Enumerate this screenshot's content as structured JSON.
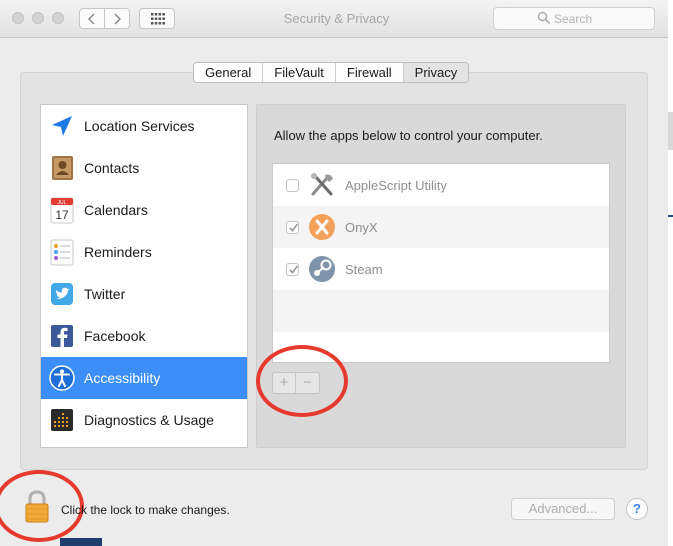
{
  "window": {
    "title": "Security & Privacy",
    "search_placeholder": "Search"
  },
  "tabs": [
    {
      "label": "General",
      "active": false
    },
    {
      "label": "FileVault",
      "active": false
    },
    {
      "label": "Firewall",
      "active": false
    },
    {
      "label": "Privacy",
      "active": true
    }
  ],
  "sidebar": {
    "items": [
      {
        "label": "Location Services",
        "icon": "location-arrow-icon",
        "selected": false
      },
      {
        "label": "Contacts",
        "icon": "contacts-book-icon",
        "selected": false
      },
      {
        "label": "Calendars",
        "icon": "calendar-icon",
        "selected": false
      },
      {
        "label": "Reminders",
        "icon": "reminders-list-icon",
        "selected": false
      },
      {
        "label": "Twitter",
        "icon": "twitter-bird-icon",
        "selected": false
      },
      {
        "label": "Facebook",
        "icon": "facebook-icon",
        "selected": false
      },
      {
        "label": "Accessibility",
        "icon": "accessibility-person-icon",
        "selected": true
      },
      {
        "label": "Diagnostics & Usage",
        "icon": "diagnostics-icon",
        "selected": false
      }
    ],
    "calendar_day": "17",
    "calendar_month": "JUL"
  },
  "panel": {
    "caption": "Allow the apps below to control your computer.",
    "apps": [
      {
        "label": "AppleScript Utility",
        "checked": false,
        "icon": "applescript-tools-icon"
      },
      {
        "label": "OnyX",
        "checked": true,
        "icon": "onyx-icon"
      },
      {
        "label": "Steam",
        "checked": true,
        "icon": "steam-icon"
      }
    ],
    "add_label": "+",
    "remove_label": "−"
  },
  "footer": {
    "lock_text": "Click the lock to make changes.",
    "advanced_label": "Advanced...",
    "help_label": "?"
  },
  "colors": {
    "selection": "#3c8ff8",
    "annotation": "#e63a2e"
  }
}
